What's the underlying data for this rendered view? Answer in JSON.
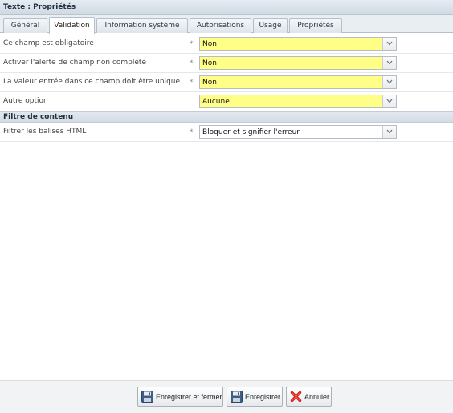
{
  "window": {
    "title": "Texte : Propriétés"
  },
  "tabs": [
    {
      "label": "Général"
    },
    {
      "label": "Validation"
    },
    {
      "label": "Information système"
    },
    {
      "label": "Autorisations"
    },
    {
      "label": "Usage"
    },
    {
      "label": "Propriétés"
    }
  ],
  "active_tab": "Validation",
  "fields": [
    {
      "label": "Ce champ est obligatoire",
      "required_mark": "*",
      "value": "Non",
      "highlight": "#ffff88"
    },
    {
      "label": "Activer l'alerte de champ non complété",
      "required_mark": "*",
      "value": "Non",
      "highlight": "#ffff88"
    },
    {
      "label": "La valeur entrée dans ce champ doit être unique",
      "required_mark": "*",
      "value": "Non",
      "highlight": "#ffff88"
    },
    {
      "label": "Autre option",
      "required_mark": "",
      "value": "Aucune",
      "highlight": "#ffff88"
    }
  ],
  "section_content_filter": {
    "title": "Filtre de contenu",
    "field": {
      "label": "Filtrer les balises HTML",
      "required_mark": "*",
      "value": "Bloquer et signifier l'erreur"
    }
  },
  "footer": {
    "save_close_label": "Enregistrer et fermer",
    "save_label": "Enregistrer",
    "cancel_label": "Annuler"
  },
  "icons": {
    "dropdown": "chevron-down-icon",
    "save": "floppy-disk-icon",
    "cancel": "red-x-icon"
  }
}
